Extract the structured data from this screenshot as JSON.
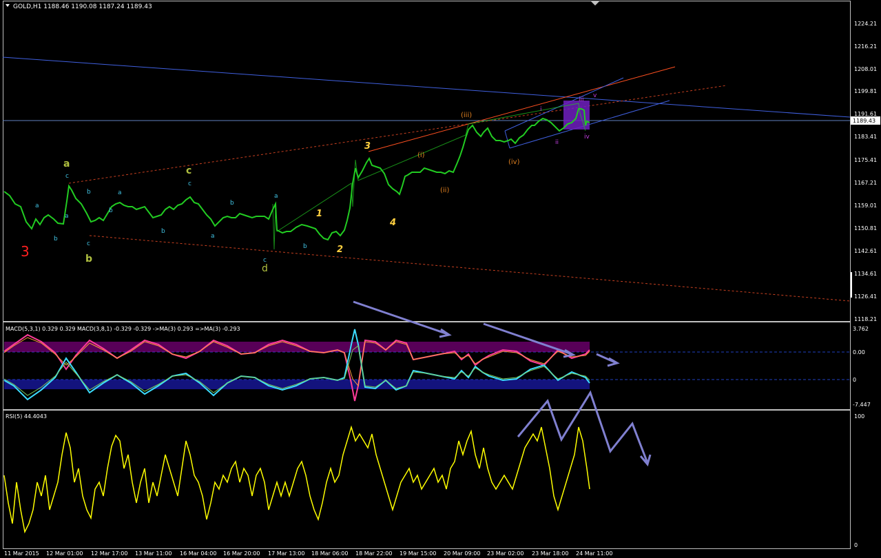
{
  "colors": {
    "background": "#000000",
    "frame": "#c0c0c0",
    "text": "#ffffff",
    "candles": "#22cc22",
    "rsi": "#ffff00",
    "macd_pink": "#ff3c9a",
    "macd_orange": "#ff9a3c",
    "macd_cyan": "#3cdcff",
    "macd_green": "#7ccd5c",
    "macd_hist_top": "#b000b0",
    "macd_hist_bottom": "#2020d0",
    "arrows": "#8080d0",
    "channel_blue": "#4060e0",
    "channel_orange": "#ff5020",
    "dashed_red": "#c84020",
    "wave_yellow_green": "#b0c040",
    "wave_cyan": "#40c0e0",
    "wave_yellow": "#ffd040",
    "wave_orange": "#e08020",
    "wave_purple": "#c040e0",
    "wave_red": "#ff2020",
    "purple_box": "#7020c0"
  },
  "main": {
    "title": "GOLD,H1  1188.46 1190.08 1187.24 1189.43",
    "current_price": "1189.43",
    "price_axis": [
      "1224.21",
      "1216.21",
      "1208.01",
      "1199.81",
      "1191.61",
      "1183.41",
      "1175.41",
      "1167.21",
      "1159.01",
      "1150.81",
      "1142.61",
      "1134.61",
      "1126.41",
      "1118.21"
    ]
  },
  "macd": {
    "title": "MACD(5,3,1) 0.329 0.329  MACD(3,8,1) -0.329 -0.329  ->MA(3) 0.293  =>MA(3) -0.293",
    "axis": [
      "3.762",
      "0.00",
      "0",
      "-7.447"
    ]
  },
  "rsi": {
    "title": "RSI(5) 44.4043",
    "axis": [
      "100",
      "0"
    ]
  },
  "time_axis": [
    "11 Mar 2015",
    "12 Mar 01:00",
    "12 Mar 17:00",
    "13 Mar 11:00",
    "16 Mar 04:00",
    "16 Mar 20:00",
    "17 Mar 13:00",
    "18 Mar 06:00",
    "18 Mar 22:00",
    "19 Mar 15:00",
    "20 Mar 09:00",
    "23 Mar 02:00",
    "23 Mar 18:00",
    "24 Mar 11:00"
  ],
  "wave_labels": {
    "big3": "3",
    "a_big": "a",
    "b_big": "b",
    "c_big": "c",
    "d_big": "d",
    "c_small1": "c",
    "c_small2": "c",
    "c_small3": "c",
    "a_s1": "a",
    "b_s1": "b",
    "a_s2": "a",
    "b_s2": "b",
    "a_s3": "a",
    "b_s3": "b",
    "a_s4": "a",
    "b_s4": "b",
    "a_s5": "a",
    "b_s5": "b",
    "y1": "1",
    "y2": "2",
    "y3": "3",
    "y4": "4",
    "oi": "(i)",
    "oii": "(ii)",
    "oiii": "(iii)",
    "oiv": "(iv)",
    "pi": "i",
    "pii": "ii",
    "piii": "iii",
    "piv": "iv",
    "pv": "v"
  }
}
